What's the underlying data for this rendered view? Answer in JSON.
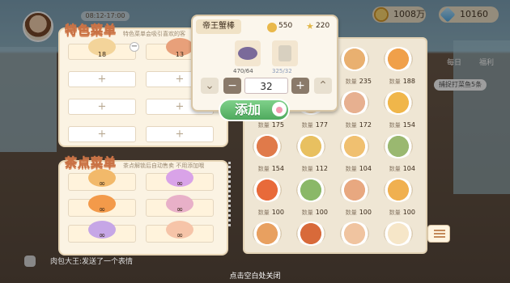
{
  "topbar": {
    "time": "08:12-17:00",
    "coins": "1008万",
    "gems": "10160"
  },
  "special_menu": {
    "title": "特色菜单",
    "note": "特色菜单会吸引喜欢的客",
    "slots": [
      {
        "count": "18",
        "filled": true,
        "color": "#f3d49a"
      },
      {
        "count": "13",
        "filled": true,
        "color": "#e8a07a"
      },
      {
        "count": "",
        "filled": false
      },
      {
        "count": "",
        "filled": false
      },
      {
        "count": "",
        "filled": false
      },
      {
        "count": "",
        "filled": false
      },
      {
        "count": "",
        "filled": false
      },
      {
        "count": "",
        "filled": false
      }
    ],
    "plus": "+",
    "minus": "−"
  },
  "dessert_menu": {
    "title": "茶点菜单",
    "note": "茶点解锁后自动售卖 不用添加哦",
    "items": [
      "∞",
      "∞",
      "∞",
      "∞",
      "∞",
      "∞"
    ],
    "colors": [
      "#f2b96a",
      "#d9a3e8",
      "#f39a4a",
      "#e8b0c8",
      "#c6a6e6",
      "#f6c4a8"
    ]
  },
  "popup": {
    "dish_name": "帝王蟹棒",
    "price_coins": "550",
    "price_stars": "220",
    "ingredient1_have": "470",
    "ingredient1_need": "64",
    "ingredient2_have": "325",
    "ingredient2_need": "32",
    "quantity": "32",
    "minus": "−",
    "plus": "+"
  },
  "add_button": "添加",
  "stock_label": "数量",
  "dishes": [
    {
      "qty": "",
      "color": "#f4c08a"
    },
    {
      "qty": "235",
      "color": "#e9b070"
    },
    {
      "qty": "188",
      "color": "#f0a04a"
    },
    {
      "qty": "175",
      "color": "#e8c8a0"
    },
    {
      "qty": "177",
      "color": "#f2d6b0"
    },
    {
      "qty": "172",
      "color": "#e7b090"
    },
    {
      "qty": "154",
      "color": "#f0b64a"
    },
    {
      "qty": "154",
      "color": "#e07a4a"
    },
    {
      "qty": "112",
      "color": "#e8c060"
    },
    {
      "qty": "104",
      "color": "#f0c070"
    },
    {
      "qty": "104",
      "color": "#9ab870"
    },
    {
      "qty": "100",
      "color": "#e86a3a"
    },
    {
      "qty": "100",
      "color": "#8ab868"
    },
    {
      "qty": "100",
      "color": "#e8a880"
    },
    {
      "qty": "100",
      "color": "#f0b050"
    },
    {
      "qty": "",
      "color": "#e8a060"
    },
    {
      "qty": "",
      "color": "#d86a3a"
    },
    {
      "qty": "",
      "color": "#f0c4a0"
    },
    {
      "qty": "",
      "color": "#f6e6c8"
    }
  ],
  "side_labels": {
    "t1": "每日",
    "t2": "福利"
  },
  "tip": "捕捉打菜鱼5条",
  "chat": "肉包大王:发送了一个表情",
  "close_hint": "点击空白处关闭"
}
